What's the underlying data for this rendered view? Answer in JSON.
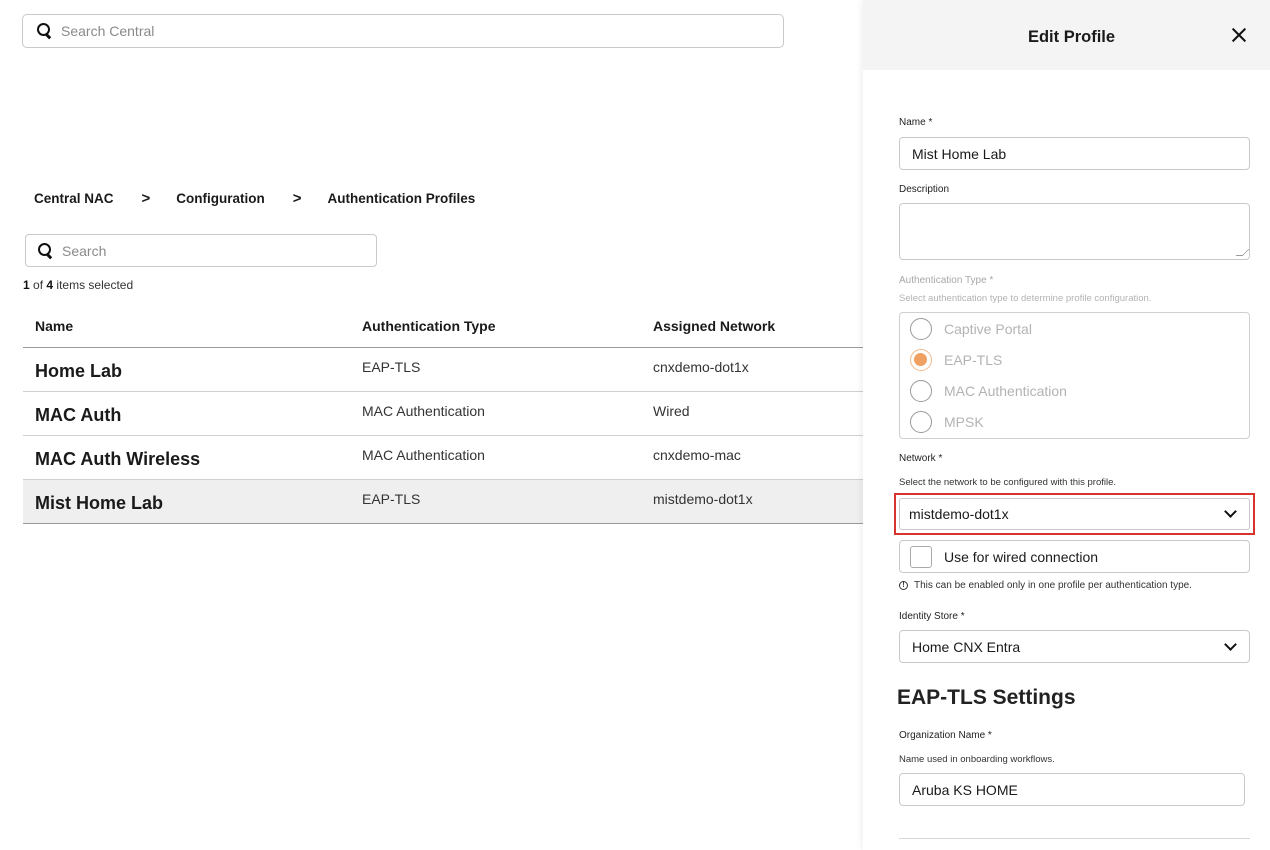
{
  "global_search": {
    "placeholder": "Search Central"
  },
  "breadcrumb": [
    "Central NAC",
    "Configuration",
    "Authentication Profiles"
  ],
  "breadcrumb_separator": ">",
  "table_search": {
    "placeholder": "Search"
  },
  "selection": {
    "selected": "1",
    "total": "4",
    "suffix": "items selected",
    "of": "of"
  },
  "table": {
    "columns": [
      "Name",
      "Authentication Type",
      "Assigned Network"
    ],
    "rows": [
      {
        "name": "Home Lab",
        "auth_type": "EAP-TLS",
        "network": "cnxdemo-dot1x",
        "selected": false
      },
      {
        "name": "MAC Auth",
        "auth_type": "MAC Authentication",
        "network": "Wired",
        "selected": false
      },
      {
        "name": "MAC Auth Wireless",
        "auth_type": "MAC Authentication",
        "network": "cnxdemo-mac",
        "selected": false
      },
      {
        "name": "Mist Home Lab",
        "auth_type": "EAP-TLS",
        "network": "mistdemo-dot1x",
        "selected": true
      }
    ]
  },
  "panel": {
    "title": "Edit Profile",
    "name_label": "Name *",
    "name_value": "Mist Home Lab",
    "description_label": "Description",
    "description_value": "",
    "auth_type_label": "Authentication Type *",
    "auth_type_hint": "Select authentication type to determine profile configuration.",
    "auth_options": [
      "Captive Portal",
      "EAP-TLS",
      "MAC Authentication",
      "MPSK"
    ],
    "auth_selected": "EAP-TLS",
    "network_label": "Network *",
    "network_hint": "Select the network to be configured with this profile.",
    "network_value": "mistdemo-dot1x",
    "wired_label": "Use for wired connection",
    "wired_note": "This can be enabled only in one profile per authentication type.",
    "identity_label": "Identity Store *",
    "identity_value": "Home CNX Entra",
    "eap_section_title": "EAP-TLS Settings",
    "org_label": "Organization Name *",
    "org_hint": "Name used in onboarding workflows.",
    "org_value": "Aruba KS HOME"
  },
  "colors": {
    "highlight_border": "#d6342c",
    "radio_selected": "#f0a060"
  }
}
